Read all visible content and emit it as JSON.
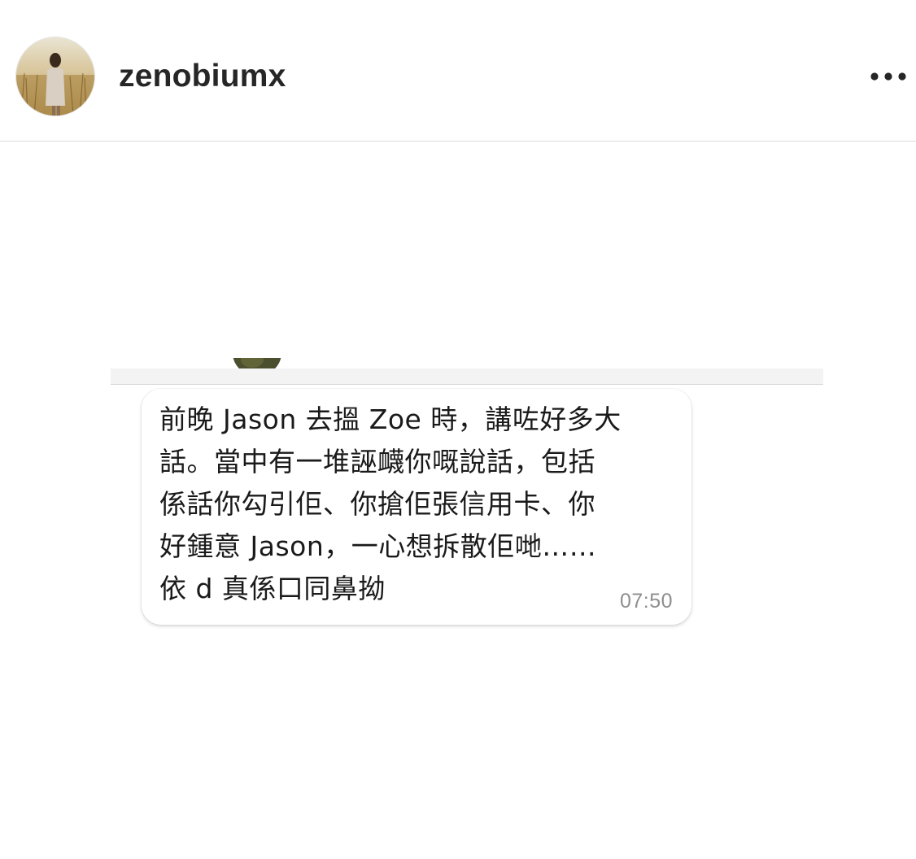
{
  "post": {
    "username": "zenobiumx",
    "more_icon": "more-horizontal-icon",
    "avatar_icon": "profile-photo"
  },
  "chat_screenshot": {
    "message": {
      "lines": [
        "前晚 Jason 去搵 Zoe 時，講咗好多大",
        "話。當中有一堆誣衊你嘅說話，包括",
        "係話你勾引佢、你搶佢張信用卡、你",
        "好鍾意 Jason，一心想拆散佢哋……",
        "依 d 真係口同鼻拗"
      ],
      "time": "07:50"
    }
  },
  "colors": {
    "username": "#262626",
    "divider": "#dbdbdb",
    "message_text": "#1a1a1a",
    "timestamp": "#8e8e8e"
  }
}
